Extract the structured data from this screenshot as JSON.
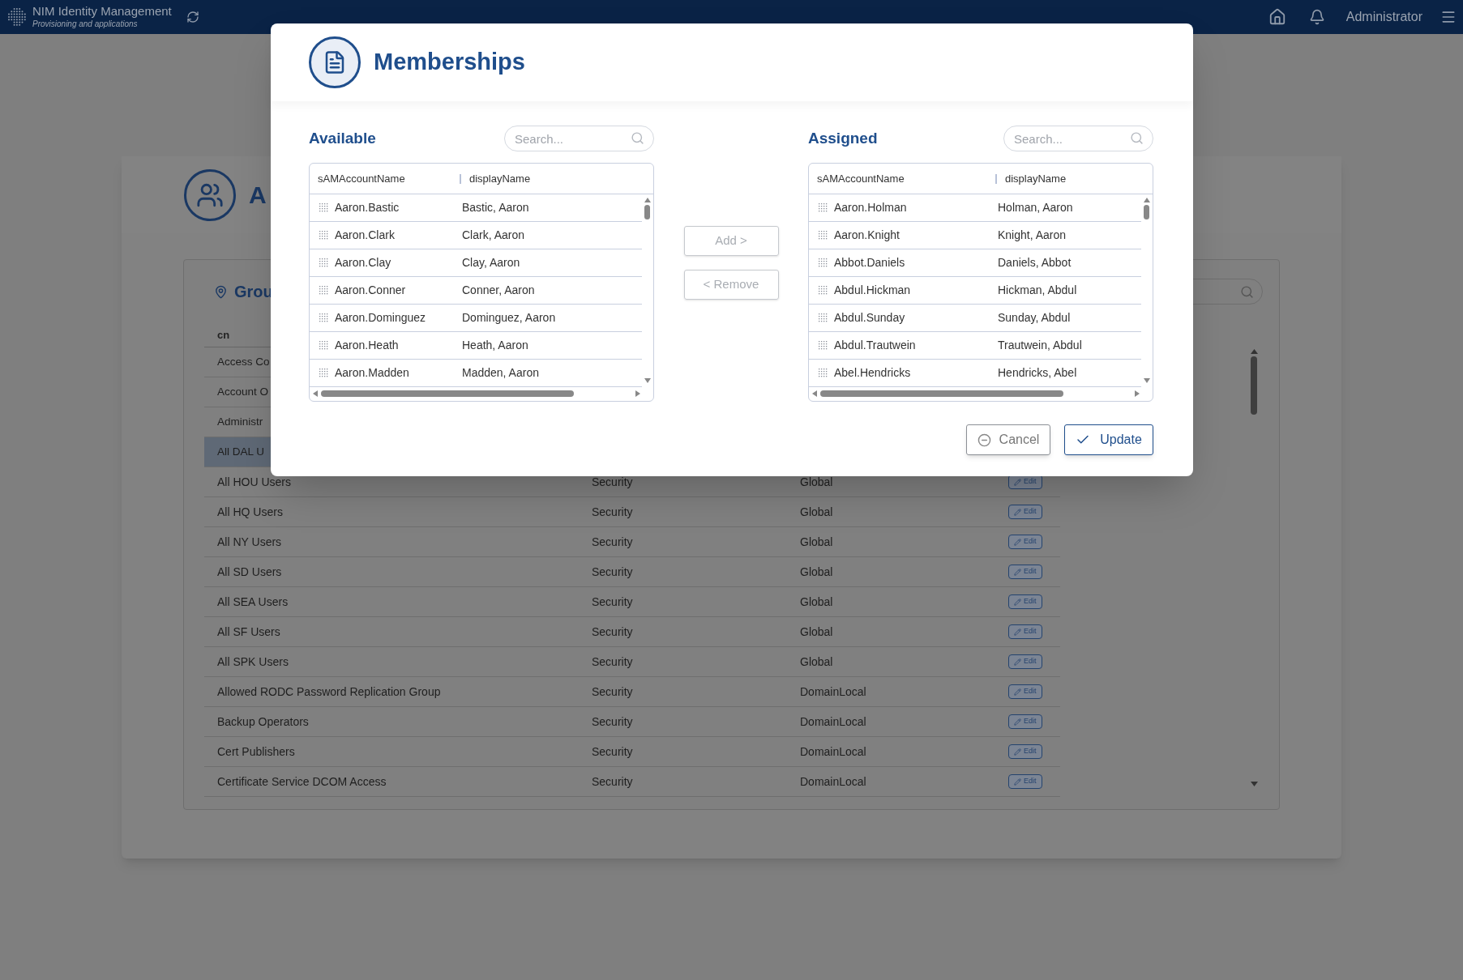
{
  "topbar": {
    "app_title": "NIM Identity Management",
    "app_subtitle": "Provisioning and applications",
    "user": "Administrator"
  },
  "page": {
    "title": "A",
    "panel_title": "Grou",
    "table": {
      "columns": [
        "cn"
      ],
      "rows": [
        {
          "cn": "Access Co",
          "selected": false
        },
        {
          "cn": "Account O",
          "selected": false
        },
        {
          "cn": "Administr",
          "selected": false
        },
        {
          "cn": "All DAL U",
          "selected": true
        },
        {
          "cn": "All HOU Users",
          "type": "Security",
          "scope": "Global",
          "action": "Edit",
          "selected": false
        },
        {
          "cn": "All HQ Users",
          "type": "Security",
          "scope": "Global",
          "action": "Edit",
          "selected": false
        },
        {
          "cn": "All NY Users",
          "type": "Security",
          "scope": "Global",
          "action": "Edit",
          "selected": false
        },
        {
          "cn": "All SD Users",
          "type": "Security",
          "scope": "Global",
          "action": "Edit",
          "selected": false
        },
        {
          "cn": "All SEA Users",
          "type": "Security",
          "scope": "Global",
          "action": "Edit",
          "selected": false
        },
        {
          "cn": "All SF Users",
          "type": "Security",
          "scope": "Global",
          "action": "Edit",
          "selected": false
        },
        {
          "cn": "All SPK Users",
          "type": "Security",
          "scope": "Global",
          "action": "Edit",
          "selected": false
        },
        {
          "cn": "Allowed RODC Password Replication Group",
          "type": "Security",
          "scope": "DomainLocal",
          "action": "Edit",
          "selected": false
        },
        {
          "cn": "Backup Operators",
          "type": "Security",
          "scope": "DomainLocal",
          "action": "Edit",
          "selected": false
        },
        {
          "cn": "Cert Publishers",
          "type": "Security",
          "scope": "DomainLocal",
          "action": "Edit",
          "selected": false
        },
        {
          "cn": "Certificate Service DCOM Access",
          "type": "Security",
          "scope": "DomainLocal",
          "action": "Edit",
          "selected": false
        }
      ]
    }
  },
  "dialog": {
    "title": "Memberships",
    "lists": [
      {
        "label": "Available",
        "search": {
          "placeholder": "Search..."
        },
        "columns": [
          "sAMAccountName",
          "displayName"
        ],
        "rows": [
          {
            "account": "Aaron.Bastic",
            "display": "Bastic, Aaron"
          },
          {
            "account": "Aaron.Clark",
            "display": "Clark, Aaron"
          },
          {
            "account": "Aaron.Clay",
            "display": "Clay, Aaron"
          },
          {
            "account": "Aaron.Conner",
            "display": "Conner, Aaron"
          },
          {
            "account": "Aaron.Dominguez",
            "display": "Dominguez, Aaron"
          },
          {
            "account": "Aaron.Heath",
            "display": "Heath, Aaron"
          },
          {
            "account": "Aaron.Madden",
            "display": "Madden, Aaron"
          }
        ]
      },
      {
        "label": "Assigned",
        "search": {
          "placeholder": "Search..."
        },
        "columns": [
          "sAMAccountName",
          "displayName"
        ],
        "rows": [
          {
            "account": "Aaron.Holman",
            "display": "Holman, Aaron"
          },
          {
            "account": "Aaron.Knight",
            "display": "Knight, Aaron"
          },
          {
            "account": "Abbot.Daniels",
            "display": "Daniels, Abbot"
          },
          {
            "account": "Abdul.Hickman",
            "display": "Hickman, Abdul"
          },
          {
            "account": "Abdul.Sunday",
            "display": "Sunday, Abdul"
          },
          {
            "account": "Abdul.Trautwein",
            "display": "Trautwein, Abdul"
          },
          {
            "account": "Abel.Hendricks",
            "display": "Hendricks, Abel"
          }
        ]
      }
    ],
    "move_buttons": [
      {
        "label": "Add >",
        "disabled": true
      },
      {
        "label": "< Remove",
        "disabled": true
      }
    ],
    "cancel": "Cancel",
    "update": "Update"
  }
}
